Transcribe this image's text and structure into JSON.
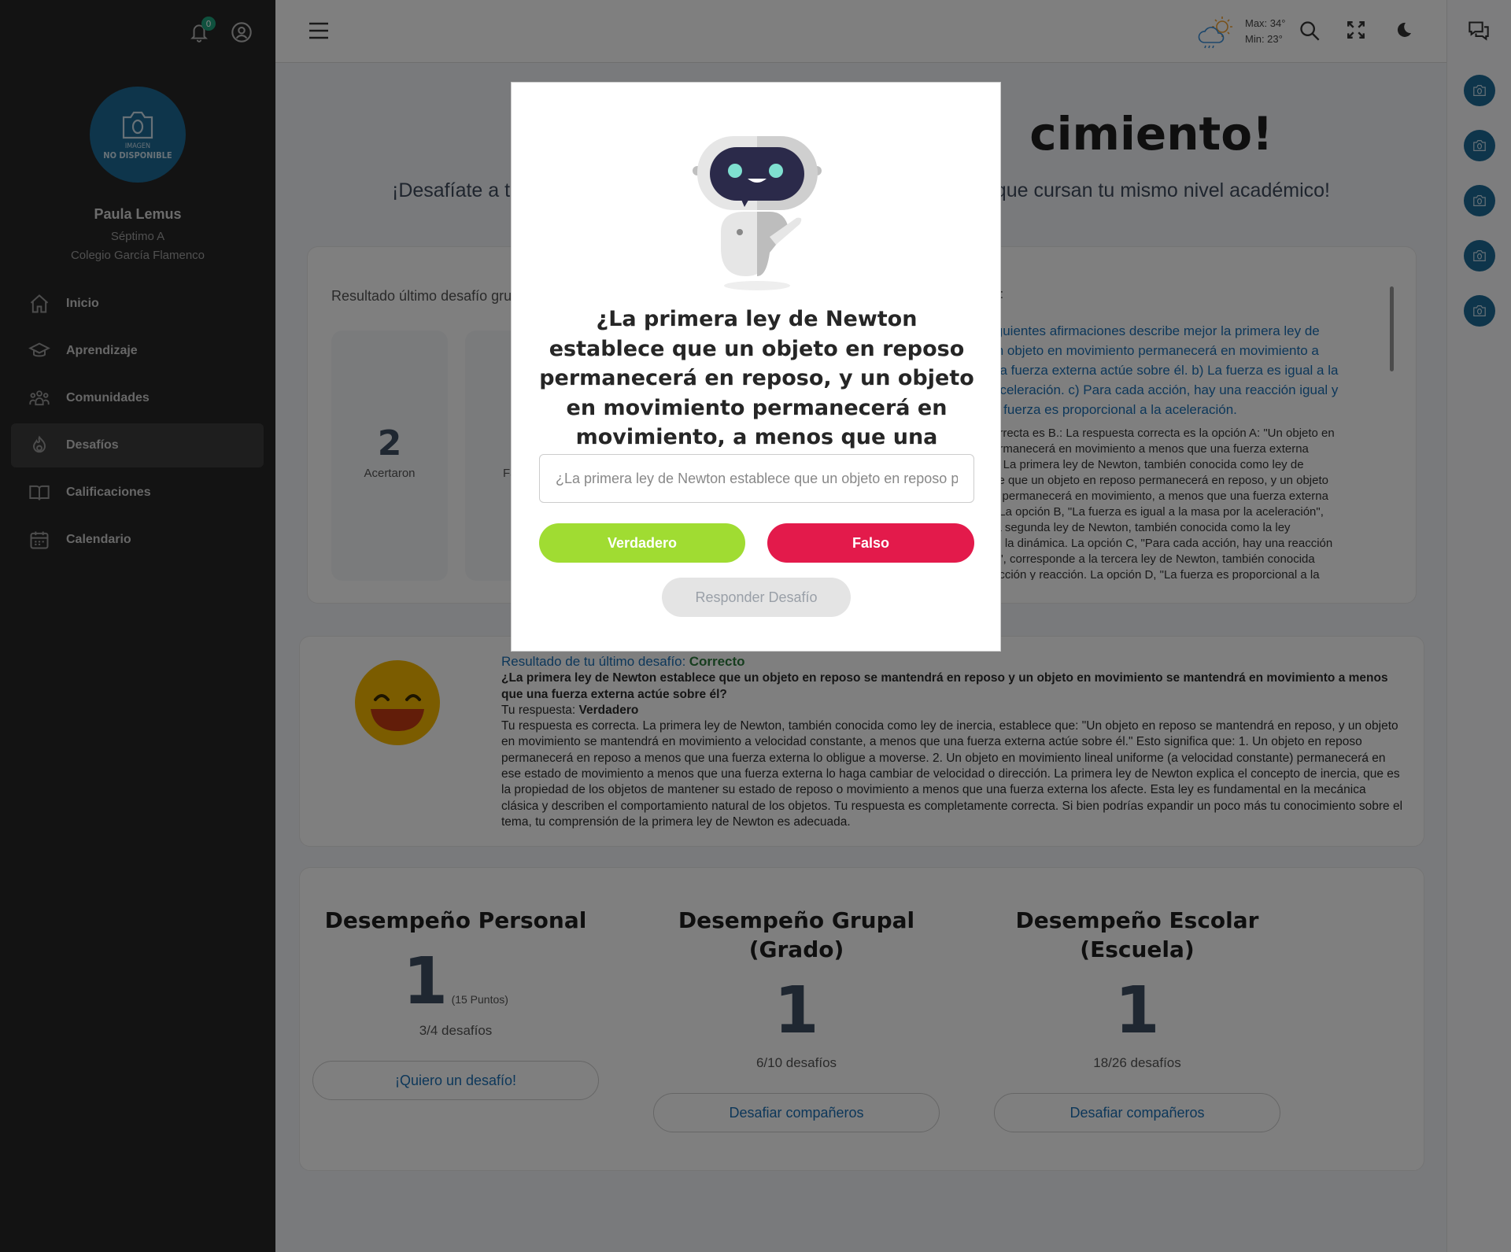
{
  "colors": {
    "accent": "#1a6fb4",
    "true_button": "#a0dc32",
    "false_button": "#e31a4b",
    "correct_text": "#2d7a3c",
    "sidebar": "#262626",
    "avatar": "#1d6a96"
  },
  "sidebar": {
    "notification_count": "0",
    "avatar_text_1": "IMAGEN",
    "avatar_text_2": "NO DISPONIBLE",
    "user_name": "Paula Lemus",
    "grade": "Séptimo A",
    "school": "Colegio García Flamenco",
    "items": [
      {
        "label": "Inicio",
        "icon": "home-icon"
      },
      {
        "label": "Aprendizaje",
        "icon": "graduation-cap-icon"
      },
      {
        "label": "Comunidades",
        "icon": "community-icon"
      },
      {
        "label": "Desafíos",
        "icon": "challenge-icon",
        "active": true
      },
      {
        "label": "Calificaciones",
        "icon": "book-icon"
      },
      {
        "label": "Calendario",
        "icon": "calendar-icon"
      }
    ]
  },
  "header": {
    "weather_max": "Max: 34°",
    "weather_min": "Min: 23°"
  },
  "main": {
    "title_visible": "cimiento!",
    "subtitle_left": "¡Desafíate a ti",
    "subtitle_right": "s que cursan tu mismo nivel académico!",
    "group_result_label": "Resultado último desafío gru",
    "stat_correct_value": "2",
    "stat_correct_label": "Acertaron",
    "stat_fail_label": "Fa",
    "right_header": "o:",
    "right_question": "iguientes afirmaciones describe mejor la primera ley de\nIn objeto en movimiento permanecerá en movimiento a\nna fuerza externa actúe sobre él. b) La fuerza es igual a la\naceleración. c) Para cada acción, hay una reacción igual y\na fuerza es proporcional a la aceleración.",
    "right_answer": "orrecta es B.: La respuesta correcta es la opción A: \"Un objeto en\nermanecerá en movimiento a menos que una fuerza externa\n\". La primera ley de Newton, también conocida como ley de\nce que un objeto en reposo permanecerá en reposo, y un objeto\no permanecerá en movimiento, a menos que una fuerza externa\n. La opción B, \"La fuerza es igual a la masa por la aceleración\",\n la segunda ley de Newton, también conocida como la ley\nle la dinámica. La opción C, \"Para cada acción, hay una reacción\na\", corresponde a la tercera ley de Newton, también conocida\n acción y reacción. La opción D, \"La fuerza es proporcional a la"
  },
  "last_result": {
    "label": "Resultado de tu último desafío:",
    "status": "Correcto",
    "question": "¿La primera ley de Newton establece que un objeto en reposo se mantendrá en reposo y un objeto en movimiento se mantendrá en movimiento a menos que una fuerza externa actúe sobre él?",
    "your_answer_label": "Tu respuesta:",
    "your_answer": "Verdadero",
    "feedback": "Tu respuesta es correcta. La primera ley de Newton, también conocida como ley de inercia, establece que: \"Un objeto en reposo se mantendrá en reposo, y un objeto en movimiento se mantendrá en movimiento a velocidad constante, a menos que una fuerza externa actúe sobre él.\" Esto significa que: 1. Un objeto en reposo permanecerá en reposo a menos que una fuerza externa lo obligue a moverse. 2. Un objeto en movimiento lineal uniforme (a velocidad constante) permanecerá en ese estado de movimiento a menos que una fuerza externa lo haga cambiar de velocidad o dirección. La primera ley de Newton explica el concepto de inercia, que es la propiedad de los objetos de mantener su estado de reposo o movimiento a menos que una fuerza externa los afecte. Esta ley es fundamental en la mecánica clásica y describen el comportamiento natural de los objetos. Tu respuesta es completamente correcta. Si bien podrías expandir un poco más tu conocimiento sobre el tema, tu comprensión de la primera ley de Newton es adecuada."
  },
  "performance": {
    "personal": {
      "title": "Desempeño Personal",
      "rank": "1",
      "points": "(15 Puntos)",
      "progress": "3/4 desafíos",
      "button": "¡Quiero un desafío!"
    },
    "group": {
      "title": "Desempeño Grupal (Grado)",
      "rank": "1",
      "progress": "6/10 desafíos",
      "button": "Desafiar compañeros"
    },
    "school": {
      "title": "Desempeño Escolar (Escuela)",
      "rank": "1",
      "progress": "18/26 desafíos",
      "button": "Desafiar compañeros"
    }
  },
  "modal": {
    "question": "¿La primera ley de Newton establece que un objeto en reposo permanecerá en reposo, y un objeto en movimiento permanecerá en movimiento, a menos que una fuerza neta actúe sobre él?",
    "input_placeholder": "¿La primera ley de Newton establece que un objeto en reposo permanecerá en reposo, y un objeto en movimiento permanecerá en movimiento, a menos que una fuerza neta actúe sobre él?",
    "true_label": "Verdadero",
    "false_label": "Falso",
    "submit_label": "Responder Desafío"
  }
}
